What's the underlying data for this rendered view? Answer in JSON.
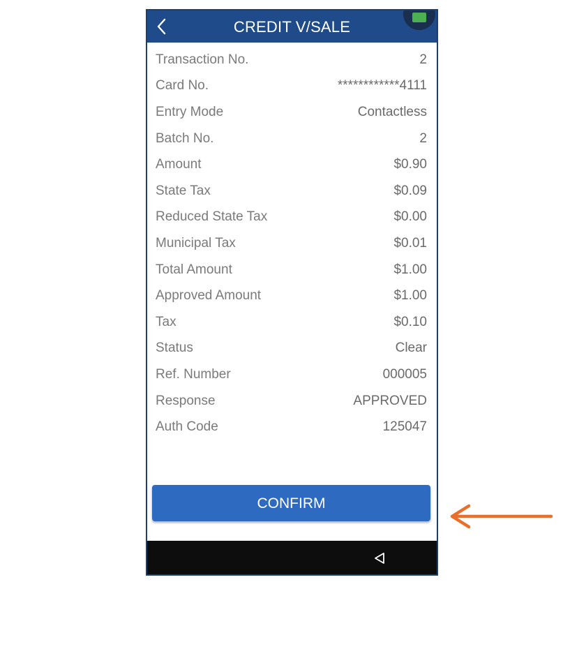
{
  "header": {
    "title": "CREDIT V/SALE",
    "back_icon": "chevron-left-icon"
  },
  "colors": {
    "header_bg": "#1f4b8a",
    "button_bg": "#2e6bc0",
    "nav_bg": "#0d0d0d",
    "arrow": "#e8702a"
  },
  "details": [
    {
      "label": "Transaction No.",
      "value": "2"
    },
    {
      "label": "Card No.",
      "value": "************4111"
    },
    {
      "label": "Entry Mode",
      "value": "Contactless"
    },
    {
      "label": "Batch No.",
      "value": "2"
    },
    {
      "label": "Amount",
      "value": "$0.90"
    },
    {
      "label": "State Tax",
      "value": "$0.09"
    },
    {
      "label": "Reduced State Tax",
      "value": "$0.00"
    },
    {
      "label": "Municipal Tax",
      "value": "$0.01"
    },
    {
      "label": "Total Amount",
      "value": "$1.00"
    },
    {
      "label": "Approved Amount",
      "value": "$1.00"
    },
    {
      "label": "Tax",
      "value": "$0.10"
    },
    {
      "label": "Status",
      "value": "Clear"
    },
    {
      "label": "Ref. Number",
      "value": "000005"
    },
    {
      "label": "Response",
      "value": "APPROVED"
    },
    {
      "label": "Auth Code",
      "value": "125047"
    }
  ],
  "confirm": {
    "label": "CONFIRM"
  },
  "navbar": {
    "back_icon": "triangle-back-icon"
  },
  "annotation": {
    "icon": "arrow-left-icon"
  }
}
